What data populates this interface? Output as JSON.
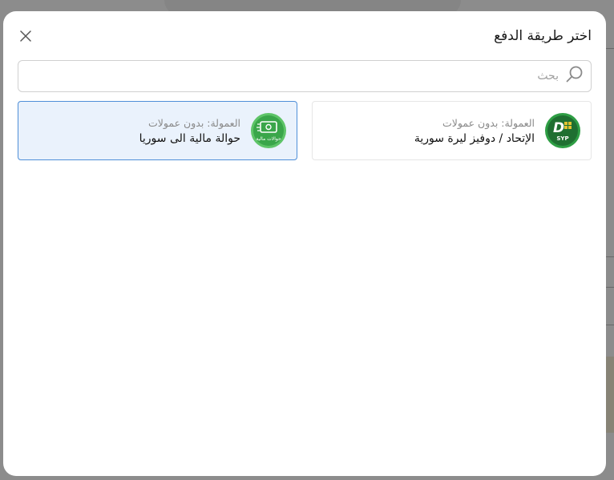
{
  "modal": {
    "title": "اختر طريقة الدفع",
    "close_icon": "close-icon"
  },
  "search": {
    "placeholder": "بحث",
    "value": "",
    "icon": "search-icon"
  },
  "methods": [
    {
      "name": "الإتحاد / دوفيز ليرة سورية",
      "fee": "العمولة: بدون عمولات",
      "logo_icon": "dovizsyp-logo-icon",
      "logo_text": "SYP",
      "selected": false
    },
    {
      "name": "حوالة مالية الى سوريا",
      "fee": "العمولة: بدون عمولات",
      "logo_icon": "money-transfer-logo-icon",
      "logo_text": "حوالات مالية",
      "selected": true
    }
  ],
  "colors": {
    "selected_bg": "#eaf2fc",
    "selected_border": "#4f8fd8",
    "logo_green": "#2e9e44"
  }
}
